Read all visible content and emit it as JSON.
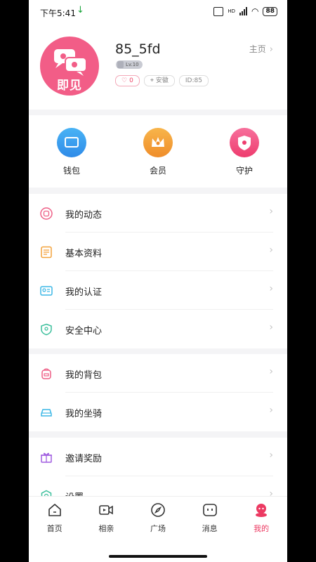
{
  "status": {
    "time": "下午5:41",
    "battery": "88",
    "network": "HD"
  },
  "profile": {
    "username": "85_5fd",
    "homepage_label": "主页",
    "level": "Lv.10",
    "likes": "0",
    "location": "安徽",
    "user_id": "ID:85",
    "avatar_brand": "即见"
  },
  "quick_actions": [
    {
      "label": "钱包",
      "icon": "wallet-icon",
      "color": "#2f96ee"
    },
    {
      "label": "会员",
      "icon": "crown-icon",
      "color": "#f3a23a"
    },
    {
      "label": "守护",
      "icon": "guard-shield-icon",
      "color": "#f25283"
    }
  ],
  "menu1": [
    {
      "label": "我的动态",
      "icon": "moments-icon"
    },
    {
      "label": "基本资料",
      "icon": "profile-doc-icon"
    },
    {
      "label": "我的认证",
      "icon": "id-card-icon"
    },
    {
      "label": "安全中心",
      "icon": "security-shield-icon"
    }
  ],
  "menu2": [
    {
      "label": "我的背包",
      "icon": "backpack-icon"
    },
    {
      "label": "我的坐骑",
      "icon": "car-icon"
    }
  ],
  "menu3": [
    {
      "label": "邀请奖励",
      "icon": "gift-icon"
    },
    {
      "label": "设置",
      "icon": "settings-icon"
    }
  ],
  "tabs": [
    {
      "label": "首页",
      "icon": "home-icon"
    },
    {
      "label": "相亲",
      "icon": "video-icon"
    },
    {
      "label": "广场",
      "icon": "compass-icon"
    },
    {
      "label": "消息",
      "icon": "message-icon"
    },
    {
      "label": "我的",
      "icon": "me-icon"
    }
  ],
  "colors": {
    "accent": "#ec3a62",
    "avatar_bg": "#f25d87"
  }
}
